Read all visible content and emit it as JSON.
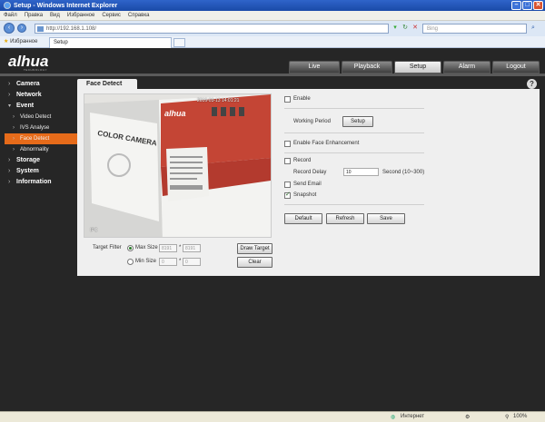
{
  "window": {
    "title": "Setup - Windows Internet Explorer"
  },
  "menu": [
    "Файл",
    "Правка",
    "Вид",
    "Избранное",
    "Сервис",
    "Справка"
  ],
  "address": {
    "url": "http://192.168.1.108/"
  },
  "search": {
    "placeholder": "Bing"
  },
  "favorites": {
    "label": "Избранное"
  },
  "browser_tab": {
    "label": "Setup"
  },
  "brand": {
    "logo": "alhua",
    "tagline": "TECHNOLOGY"
  },
  "nav": {
    "items": [
      "Live",
      "Playback",
      "Setup",
      "Alarm",
      "Logout"
    ],
    "active": "Setup"
  },
  "sidebar": {
    "items": [
      {
        "label": "Camera"
      },
      {
        "label": "Network"
      },
      {
        "label": "Event"
      },
      {
        "label": "Video Detect"
      },
      {
        "label": "IVS Analyse"
      },
      {
        "label": "Face Detect"
      },
      {
        "label": "Abnormality"
      },
      {
        "label": "Storage"
      },
      {
        "label": "System"
      },
      {
        "label": "Information"
      }
    ]
  },
  "panel": {
    "title": "Face Detect"
  },
  "video": {
    "osd_time": "2016-03-13 14:01:21",
    "osd_channel": "IPC"
  },
  "filter": {
    "label": "Target Filter",
    "max_label": "Max Size",
    "max_w": "8191",
    "max_h": "8191",
    "min_label": "Min Size",
    "min_w": "0",
    "min_h": "0",
    "draw_target": "Draw Target",
    "clear": "Clear",
    "times": "*"
  },
  "settings": {
    "enable": "Enable",
    "working_period": "Working Period",
    "setup_btn": "Setup",
    "face_enhancement": "Enable Face Enhancement",
    "record": "Record",
    "record_delay_label": "Record Delay",
    "record_delay_value": "10",
    "record_delay_unit": "Second (10~300)",
    "send_email": "Send Email",
    "snapshot": "Snapshot",
    "default_btn": "Default",
    "refresh_btn": "Refresh",
    "save_btn": "Save"
  },
  "statusbar": {
    "zone": "Интернет",
    "zoom": "100%"
  }
}
